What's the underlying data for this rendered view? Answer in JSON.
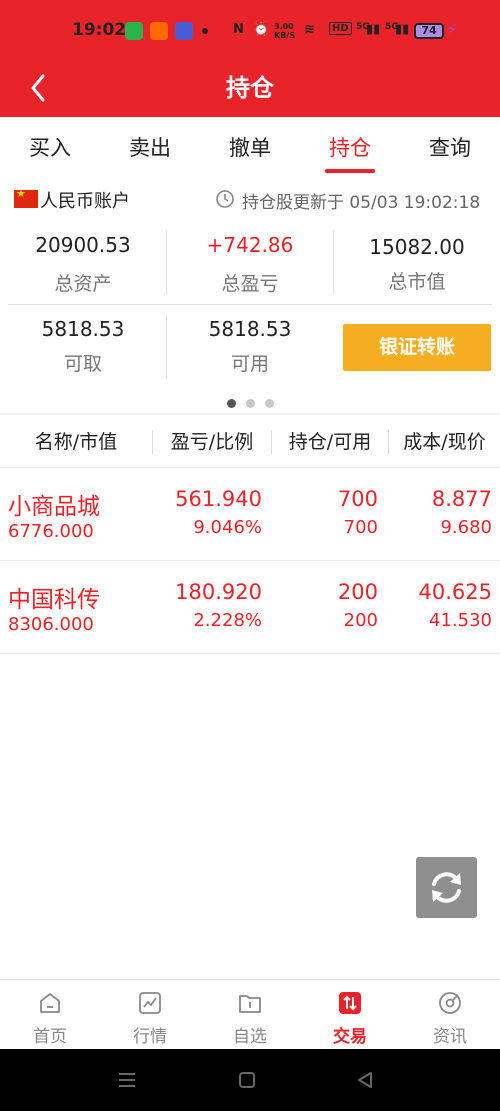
{
  "status_bar": {
    "time": "19:02",
    "net_speed": "3.00 KB/S",
    "battery": "74",
    "signal_1": "5G",
    "signal_2": "5G",
    "hd": "HD"
  },
  "header": {
    "title": "持仓"
  },
  "tabs": [
    {
      "label": "买入"
    },
    {
      "label": "卖出"
    },
    {
      "label": "撤单"
    },
    {
      "label": "持仓"
    },
    {
      "label": "查询"
    }
  ],
  "account": {
    "name": "人民币账户",
    "update_text": "持仓股更新于 05/03 19:02:18"
  },
  "summary": {
    "total_assets": {
      "value": "20900.53",
      "label": "总资产"
    },
    "total_pnl": {
      "value": "+742.86",
      "label": "总盈亏"
    },
    "market_value": {
      "value": "15082.00",
      "label": "总市值"
    },
    "withdrawable": {
      "value": "5818.53",
      "label": "可取"
    },
    "available": {
      "value": "5818.53",
      "label": "可用"
    },
    "transfer_button": "银证转账"
  },
  "table": {
    "headers": [
      "名称/市值",
      "盈亏/比例",
      "持仓/可用",
      "成本/现价"
    ],
    "rows": [
      {
        "name": "小商品城",
        "market_value": "6776.000",
        "pnl": "561.940",
        "ratio": "9.046%",
        "position": "700",
        "available": "700",
        "cost": "8.877",
        "price": "9.680"
      },
      {
        "name": "中国科传",
        "market_value": "8306.000",
        "pnl": "180.920",
        "ratio": "2.228%",
        "position": "200",
        "available": "200",
        "cost": "40.625",
        "price": "41.530"
      }
    ]
  },
  "bottom_nav": [
    {
      "label": "首页",
      "icon": "home-icon"
    },
    {
      "label": "行情",
      "icon": "market-chart-icon"
    },
    {
      "label": "自选",
      "icon": "watchlist-icon"
    },
    {
      "label": "交易",
      "icon": "trade-icon"
    },
    {
      "label": "资讯",
      "icon": "news-icon"
    }
  ],
  "colors": {
    "brand_red": "#e8242a",
    "button_orange": "#f5ae22"
  }
}
